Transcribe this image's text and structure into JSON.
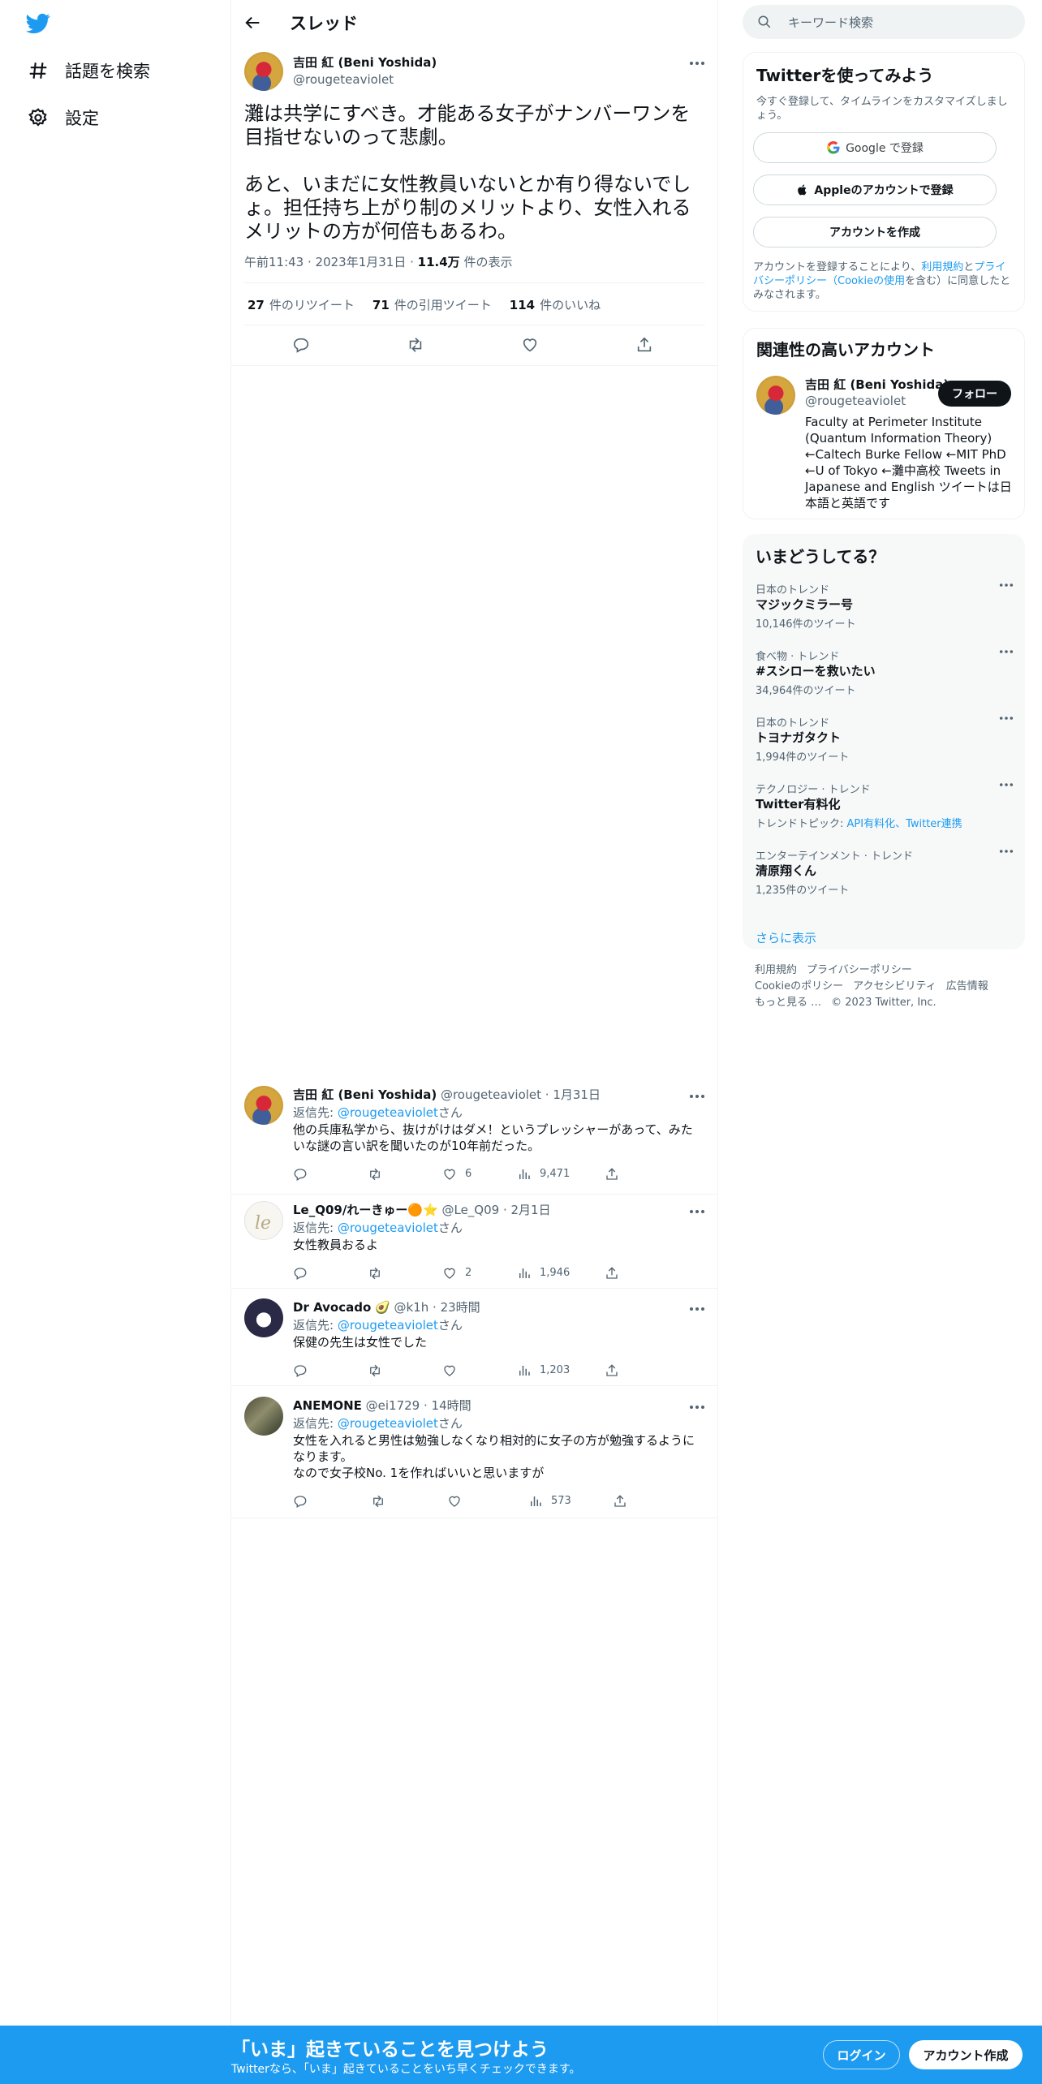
{
  "nav": {
    "explore_label": "話題を検索",
    "settings_label": "設定"
  },
  "header": {
    "title": "スレッド"
  },
  "tweet": {
    "author": "吉田 紅 (Beni Yoshida)",
    "handle": "@rougeteaviolet",
    "text": "灘は共学にすべき。才能ある女子がナンバーワンを目指せないのって悲劇。\n\nあと、いまだに女性教員いないとか有り得ないでしょ。担任持ち上がり制のメリットより、女性入れるメリットの方が何倍もあるわ。",
    "time": "午前11:43",
    "date": "2023年1月31日",
    "views_count": "11.4万",
    "views_label": "件の表示",
    "retweets_count": "27",
    "retweets_label": "件のリツイート",
    "quotes_count": "71",
    "quotes_label": "件の引用ツイート",
    "likes_count": "114",
    "likes_label": "件のいいね"
  },
  "reply_prefix": "返信先: ",
  "reply_suffix": "さん",
  "replies": [
    {
      "name": "吉田 紅 (Beni Yoshida)",
      "handle_time": " @rougeteaviolet · 1月31日",
      "to": "@rougeteaviolet",
      "text": "他の兵庫私学から、抜けがけはダメ！というプレッシャーがあって、みたいな謎の言い訳を聞いたのが10年前だった。",
      "likes": "6",
      "views": "9,471"
    },
    {
      "name": "Le_Q09/れーきゅー",
      "emoji": "🟠⭐",
      "handle_time": " @Le_Q09 · 2月1日",
      "to": "@rougeteaviolet",
      "text": "女性教員おるよ",
      "likes": "2",
      "views": "1,946"
    },
    {
      "name": "Dr Avocado",
      "emoji": "🥑",
      "handle_time": " @k1h · 23時間",
      "to": "@rougeteaviolet",
      "text": "保健の先生は女性でした",
      "likes": "",
      "views": "1,203"
    },
    {
      "name": "ANEMONE",
      "handle_time": " @ei1729 · 14時間",
      "to": "@rougeteaviolet",
      "text": "女性を入れると男性は勉強しなくなり相対的に女子の方が勉強するようになります。\nなので女子校No. 1を作ればいいと思いますが",
      "likes": "",
      "views": "573"
    }
  ],
  "search": {
    "placeholder": "キーワード検索"
  },
  "signup": {
    "title": "Twitterを使ってみよう",
    "subtitle": "今すぐ登録して、タイムラインをカスタマイズしましょう。",
    "google": "Google で登録",
    "apple": "Appleのアカウントで登録",
    "create": "アカウントを作成",
    "legal_1": "アカウントを登録することにより、",
    "legal_terms": "利用規約",
    "legal_2": "と",
    "legal_privacy": "プライバシーポリシー（Cookieの使用",
    "legal_3": "を含む）に同意したとみなされます。"
  },
  "relevant": {
    "title": "関連性の高いアカウント",
    "name": "吉田 紅 (Beni Yoshida)",
    "handle": "@rougeteaviolet",
    "follow": "フォロー",
    "bio": "Faculty at Perimeter Institute (Quantum Information Theory) ←Caltech Burke Fellow ←MIT PhD ←U of Tokyo ←灘中高校 Tweets in Japanese and English ツイートは日本語と英語です"
  },
  "trends": {
    "title": "いまどうしてる？",
    "items": [
      {
        "category": "日本のトレンド",
        "name": "マジックミラー号",
        "count": "10,146件のツイート"
      },
      {
        "category": "食べ物 · トレンド",
        "name": "#スシローを救いたい",
        "count": "34,964件のツイート"
      },
      {
        "category": "日本のトレンド",
        "name": "トヨナガタクト",
        "count": "1,994件のツイート"
      },
      {
        "category": "テクノロジー · トレンド",
        "name": "Twitter有料化",
        "topic_label": "トレンドトピック: ",
        "topic_links": "API有料化、Twitter連携"
      },
      {
        "category": "エンターテインメント · トレンド",
        "name": "清原翔くん",
        "count": "1,235件のツイート"
      }
    ],
    "show_more": "さらに表示"
  },
  "footer": {
    "terms": "利用規約",
    "privacy": "プライバシーポリシー",
    "cookie": "Cookieのポリシー",
    "accessibility": "アクセシビリティ",
    "ads": "広告情報",
    "more": "もっと見る …",
    "copyright": "© 2023 Twitter, Inc."
  },
  "bottom": {
    "title": "「いま」起きていることを見つけよう",
    "subtitle": "Twitterなら、「いま」起きていることをいち早くチェックできます。",
    "login": "ログイン",
    "signup": "アカウント作成"
  },
  "colors": {
    "accent": "#1d9bf0",
    "text": "#0f1419",
    "muted": "#536471"
  }
}
